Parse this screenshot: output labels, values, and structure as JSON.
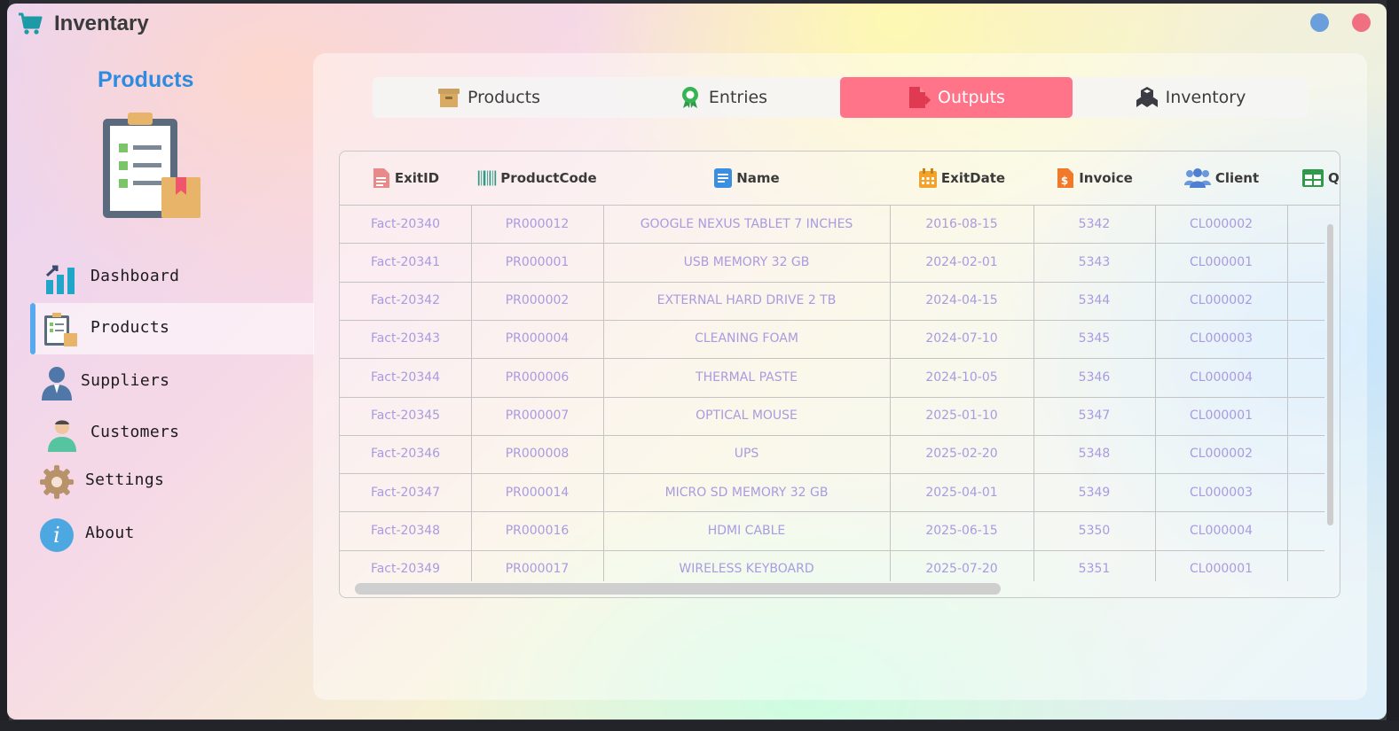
{
  "window": {
    "title": "Inventary",
    "app_icon": "shopping-cart-icon"
  },
  "sidebar": {
    "title": "Products",
    "hero_icon": "clipboard-box-icon",
    "items": [
      {
        "label": "Dashboard",
        "icon": "bar-chart-icon",
        "active": false
      },
      {
        "label": "Products",
        "icon": "clipboard-icon",
        "active": true
      },
      {
        "label": "Suppliers",
        "icon": "supplier-person-icon",
        "active": false
      },
      {
        "label": "Customers",
        "icon": "customer-person-icon",
        "active": false
      },
      {
        "label": "Settings",
        "icon": "gear-icon",
        "active": false
      },
      {
        "label": "About",
        "icon": "info-icon",
        "active": false
      }
    ]
  },
  "tabs": [
    {
      "label": "Products",
      "icon": "box-icon",
      "active": false
    },
    {
      "label": "Entries",
      "icon": "ribbon-icon",
      "active": false
    },
    {
      "label": "Outputs",
      "icon": "file-export-icon",
      "active": true
    },
    {
      "label": "Inventory",
      "icon": "boxes-icon",
      "active": false
    }
  ],
  "table": {
    "columns": [
      {
        "label": "ExitID",
        "icon": "document-icon"
      },
      {
        "label": "ProductCode",
        "icon": "barcode-icon"
      },
      {
        "label": "Name",
        "icon": "file-text-icon"
      },
      {
        "label": "ExitDate",
        "icon": "calendar-icon"
      },
      {
        "label": "Invoice",
        "icon": "invoice-icon"
      },
      {
        "label": "Client",
        "icon": "users-icon"
      },
      {
        "label": "Q",
        "icon": "grid-table-icon"
      }
    ],
    "rows": [
      [
        "Fact-20340",
        "PR000012",
        "GOOGLE NEXUS TABLET 7 INCHES",
        "2016-08-15",
        "5342",
        "CL000002",
        ""
      ],
      [
        "Fact-20341",
        "PR000001",
        "USB MEMORY 32 GB",
        "2024-02-01",
        "5343",
        "CL000001",
        ""
      ],
      [
        "Fact-20342",
        "PR000002",
        "EXTERNAL HARD DRIVE 2 TB",
        "2024-04-15",
        "5344",
        "CL000002",
        ""
      ],
      [
        "Fact-20343",
        "PR000004",
        "CLEANING FOAM",
        "2024-07-10",
        "5345",
        "CL000003",
        ""
      ],
      [
        "Fact-20344",
        "PR000006",
        "THERMAL PASTE",
        "2024-10-05",
        "5346",
        "CL000004",
        ""
      ],
      [
        "Fact-20345",
        "PR000007",
        "OPTICAL MOUSE",
        "2025-01-10",
        "5347",
        "CL000001",
        ""
      ],
      [
        "Fact-20346",
        "PR000008",
        "UPS",
        "2025-02-20",
        "5348",
        "CL000002",
        ""
      ],
      [
        "Fact-20347",
        "PR000014",
        "MICRO SD MEMORY 32 GB",
        "2025-04-01",
        "5349",
        "CL000003",
        ""
      ],
      [
        "Fact-20348",
        "PR000016",
        "HDMI CABLE",
        "2025-06-15",
        "5350",
        "CL000004",
        ""
      ],
      [
        "Fact-20349",
        "PR000017",
        "WIRELESS KEYBOARD",
        "2025-07-20",
        "5351",
        "CL000001",
        ""
      ]
    ]
  }
}
